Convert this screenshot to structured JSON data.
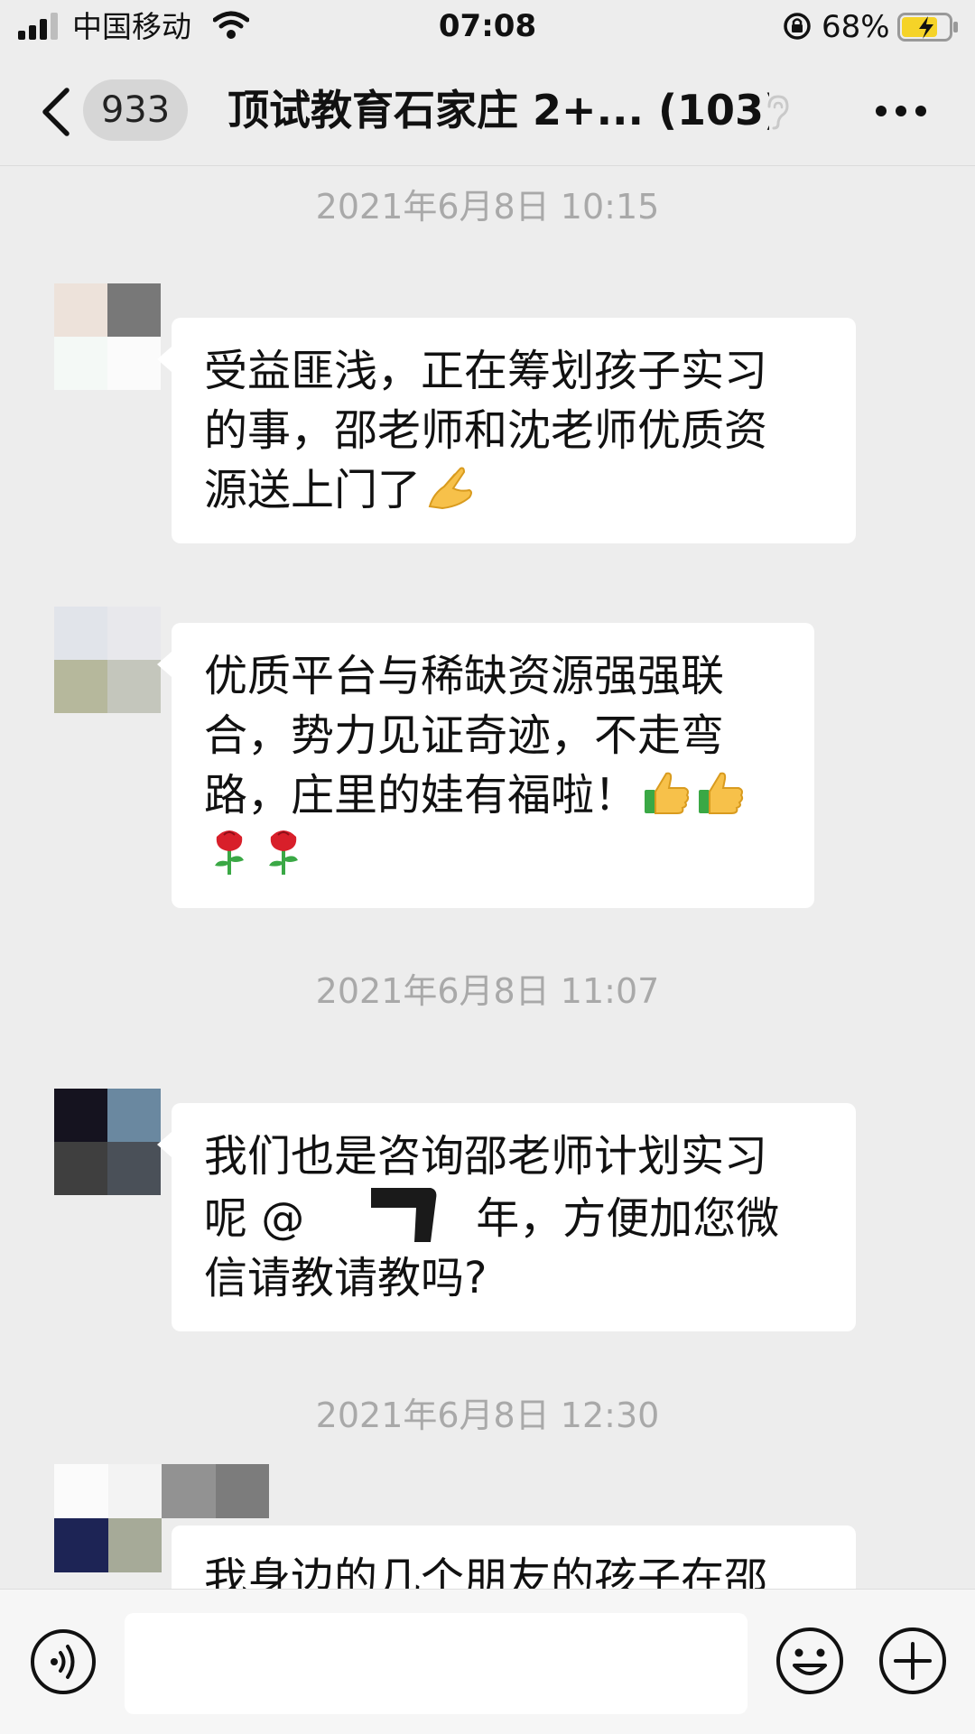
{
  "status_bar": {
    "carrier": "中国移动",
    "time": "07:08",
    "battery_percent": "68%"
  },
  "nav": {
    "unread_count": "933",
    "title": "顶试教育石家庄 2+... (103)"
  },
  "messages": [
    {
      "timestamp": "2021年6月8日 10:15",
      "lines": [
        "受益匪浅，正在筹划孩子实习",
        "的事，邵老师和沈老师优质资",
        "源送上门了"
      ],
      "emoji": "folded-hands"
    },
    {
      "timestamp": "",
      "lines": [
        "优质平台与稀缺资源强强联",
        "合，势力见证奇迹，不走弯",
        "路，庄里的娃有福啦！"
      ],
      "emoji": "thumbs-up thumbs-up rose rose"
    },
    {
      "timestamp": "2021年6月8日 11:07",
      "lines": [
        "我们也是咨询邵老师计划实习",
        "呢 @",
        "年，方便加您微",
        "信请教请教吗?"
      ]
    },
    {
      "timestamp": "2021年6月8日 12:30",
      "lines": [
        "我身边的几个朋友的孩子在邵"
      ]
    }
  ],
  "input": {
    "value": "",
    "placeholder": ""
  },
  "colors": {
    "background": "#ededed",
    "bubble": "#ffffff",
    "timestamp": "#a9a9a9",
    "battery_fill": "#f5d328"
  },
  "icons": [
    "signal-icon",
    "wifi-icon",
    "rotation-lock-icon",
    "battery-charging-icon",
    "back-chevron-icon",
    "ear-icon",
    "more-icon",
    "voice-icon",
    "emoji-face-icon",
    "plus-icon"
  ]
}
